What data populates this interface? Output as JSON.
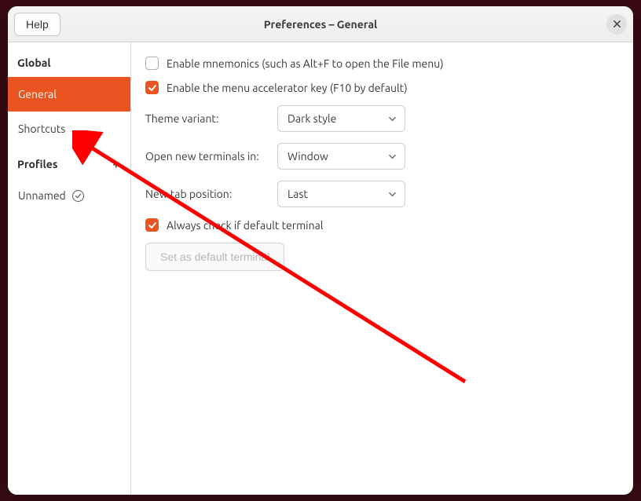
{
  "titlebar": {
    "help": "Help",
    "title": "Preferences – General"
  },
  "sidebar": {
    "global_label": "Global",
    "items": [
      "General",
      "Shortcuts"
    ],
    "profiles_label": "Profiles",
    "profiles": [
      "Unnamed"
    ]
  },
  "content": {
    "mnemonics_label": "Enable mnemonics (such as Alt+F to open the File menu)",
    "accel_label": "Enable the menu accelerator key (F10 by default)",
    "theme_label": "Theme variant:",
    "theme_value": "Dark style",
    "open_label": "Open new terminals in:",
    "open_value": "Window",
    "tabpos_label": "New tab position:",
    "tabpos_value": "Last",
    "defcheck_label": "Always check if default terminal",
    "defbtn_label": "Set as default terminal"
  }
}
